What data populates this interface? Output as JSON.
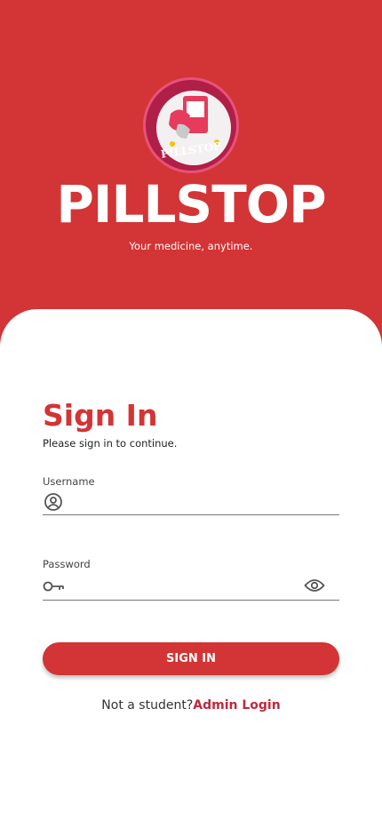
{
  "app": {
    "title": "PILLSTOP",
    "tagline": "Your medicine, anytime.",
    "logo_text": "PILLSTOP"
  },
  "signin": {
    "title": "Sign In",
    "subtitle": "Please sign in to continue.",
    "username_label": "Username",
    "username_value": "",
    "password_label": "Password",
    "password_value": "",
    "button_label": "SIGN IN",
    "footer_prompt": "Not a student?",
    "admin_link": "Admin Login"
  },
  "icons": {
    "username": "user-circle-icon",
    "password": "key-icon",
    "visibility": "eye-icon"
  },
  "colors": {
    "brand_red": "#d33435",
    "logo_bg": "#b01f47",
    "card_bg": "#ffffff"
  }
}
